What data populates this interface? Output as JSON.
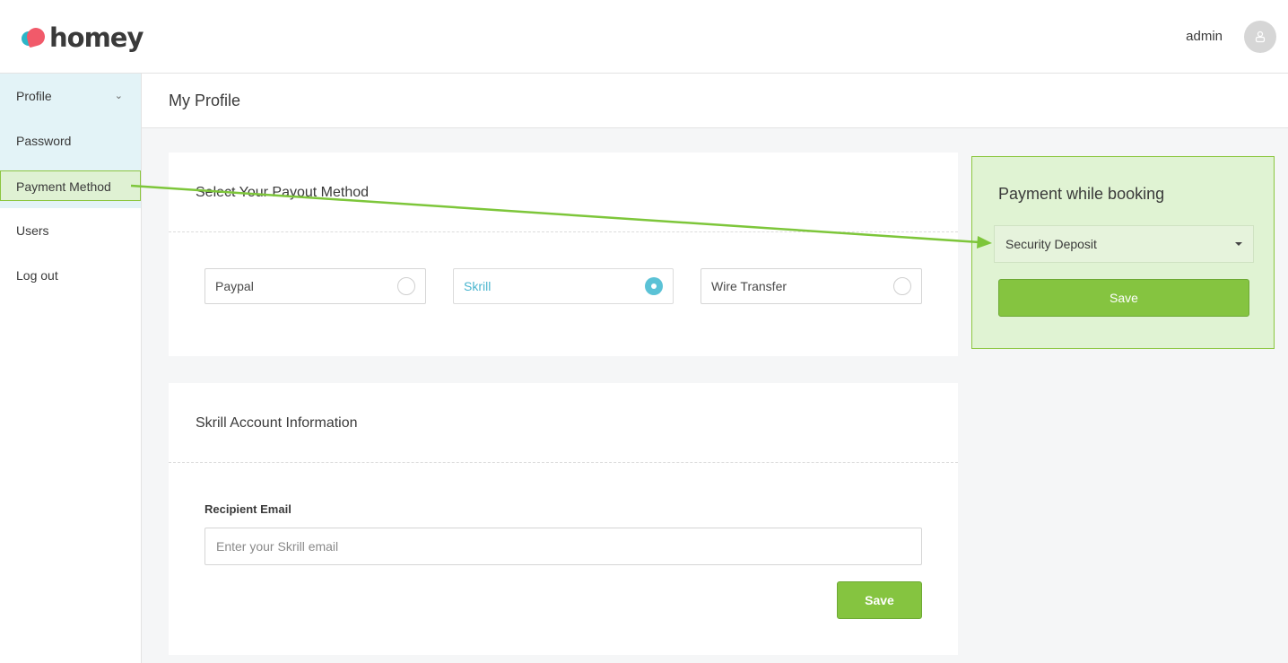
{
  "header": {
    "logo_text": "homey",
    "user_name": "admin",
    "avatar_icon": "user-icon"
  },
  "sidebar": {
    "items": [
      {
        "label": "Profile",
        "has_chevron": true
      },
      {
        "label": "Password"
      },
      {
        "label": "Payment Method",
        "active": true
      },
      {
        "label": "Users"
      },
      {
        "label": "Log out"
      }
    ],
    "chevron": "⌄"
  },
  "page": {
    "title": "My Profile"
  },
  "payout": {
    "title": "Select Your Payout Method",
    "methods": [
      {
        "label": "Paypal",
        "selected": false
      },
      {
        "label": "Skrill",
        "selected": true
      },
      {
        "label": "Wire Transfer",
        "selected": false
      }
    ]
  },
  "skrill": {
    "title": "Skrill Account Information",
    "email_label": "Recipient Email",
    "email_value": "",
    "email_placeholder": "Enter your Skrill email",
    "save_label": "Save"
  },
  "booking": {
    "title": "Payment while booking",
    "selected_option": "Security Deposit",
    "save_label": "Save"
  },
  "colors": {
    "accent_green": "#85c440",
    "accent_teal": "#5bc2d6",
    "highlight_bg": "#e0f3d3",
    "annotation_arrow": "#7dc63a"
  }
}
